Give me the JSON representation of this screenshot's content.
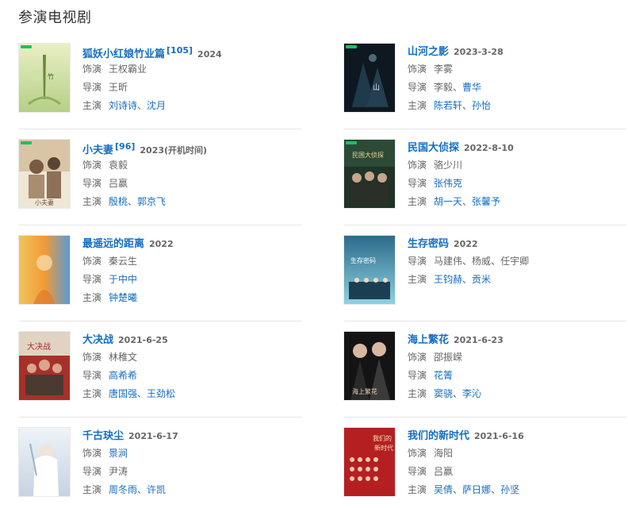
{
  "section_title": "参演电视剧",
  "labels": {
    "role": "饰演",
    "director": "导演",
    "cast": "主演",
    "sep": "、"
  },
  "left": [
    {
      "title": "狐妖小红娘竹业篇",
      "sup": "[105]",
      "date": "2024",
      "role": "王权霸业",
      "director": [
        "王昕"
      ],
      "cast": [
        "刘诗诗",
        "沈月"
      ],
      "director_linked": false,
      "role_linked": false
    },
    {
      "title": "小夫妻",
      "sup": "[96]",
      "date": "2023(开机时间)",
      "role": "袁毅",
      "director": [
        "吕赢"
      ],
      "cast": [
        "殷桃",
        "郭京飞"
      ],
      "director_linked": false,
      "role_linked": false
    },
    {
      "title": "最遥远的距离",
      "sup": "",
      "date": "2022",
      "role": "秦云生",
      "director": [
        "于中中"
      ],
      "cast": [
        "钟楚曦"
      ],
      "director_linked": true,
      "role_linked": false
    },
    {
      "title": "大决战",
      "sup": "",
      "date": "2021-6-25",
      "role": "林稚文",
      "director": [
        "高希希"
      ],
      "cast": [
        "唐国强",
        "王劲松"
      ],
      "director_linked": true,
      "role_linked": false
    },
    {
      "title": "千古玦尘",
      "sup": "",
      "date": "2021-6-17",
      "role": "景涧",
      "director": [
        "尹涛"
      ],
      "cast": [
        "周冬雨",
        "许凯"
      ],
      "director_linked": false,
      "role_linked": true
    }
  ],
  "right": [
    {
      "title": "山河之影",
      "sup": "",
      "date": "2023-3-28",
      "role": "李雾",
      "director": [
        "李毅",
        "曹华"
      ],
      "cast": [
        "陈若轩",
        "孙怡"
      ],
      "director_linked": false,
      "role_linked": false,
      "director_link_index": [
        1
      ]
    },
    {
      "title": "民国大侦探",
      "sup": "",
      "date": "2022-8-10",
      "role": "骆少川",
      "director": [
        "张伟克"
      ],
      "cast": [
        "胡一天",
        "张馨予"
      ],
      "director_linked": true,
      "role_linked": false
    },
    {
      "title": "生存密码",
      "sup": "",
      "date": "2022",
      "role": "",
      "director": [
        "马建伟",
        "杨威",
        "任宇卿"
      ],
      "cast": [
        "王钧赫",
        "贡米"
      ],
      "director_linked": false,
      "role_linked": false,
      "no_role": true
    },
    {
      "title": "海上繁花",
      "sup": "",
      "date": "2021-6-23",
      "role": "邵振嵘",
      "director": [
        "花箐"
      ],
      "cast": [
        "窦骁",
        "李沁"
      ],
      "director_linked": true,
      "role_linked": false
    },
    {
      "title": "我们的新时代",
      "sup": "",
      "date": "2021-6-16",
      "role": "海阳",
      "director": [
        "吕赢"
      ],
      "cast": [
        "吴倩",
        "萨日娜",
        "孙坚"
      ],
      "director_linked": false,
      "role_linked": false
    }
  ],
  "colors": {
    "link": "#136ec2",
    "muted": "#666666",
    "divider": "#e6e6e6"
  }
}
